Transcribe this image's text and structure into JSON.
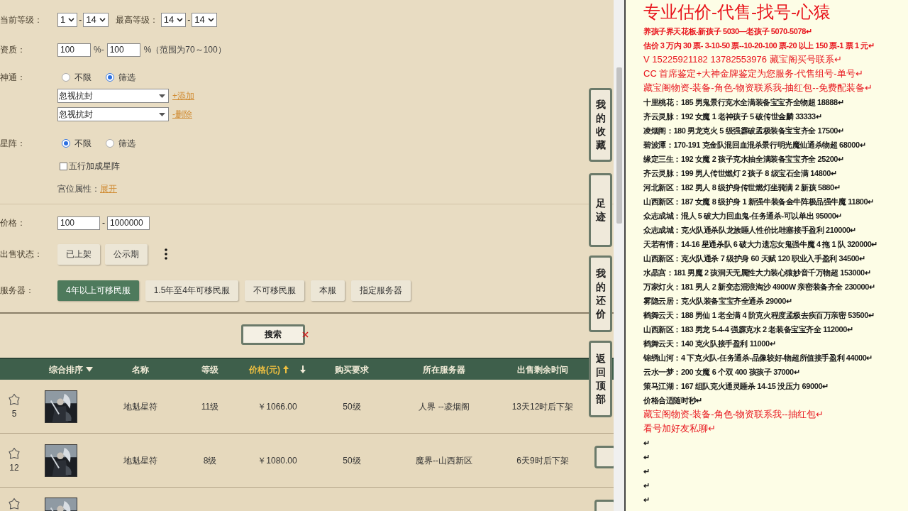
{
  "filters": {
    "level": {
      "label": "当前等级：",
      "from": "1",
      "dash": "-",
      "to": "14",
      "max_label": "最高等级：",
      "max_from": "14",
      "max_to": "14"
    },
    "aptitude": {
      "label": "资质：",
      "from": "100",
      "unit": "%",
      "dash": "-",
      "to": "100",
      "hint": "%（范围为70～100）"
    },
    "skills": {
      "label": "神通：",
      "options": [
        {
          "label": "不限",
          "selected": false
        },
        {
          "label": "筛选",
          "selected": true
        }
      ],
      "selects": [
        {
          "value": "忽视抗封",
          "link": "+添加"
        },
        {
          "value": "忽视抗封",
          "link": "-删除"
        }
      ]
    },
    "star_array": {
      "label": "星阵：",
      "options": [
        {
          "label": "不限",
          "selected": true
        },
        {
          "label": "筛选",
          "selected": false
        }
      ],
      "checkbox": {
        "label": "五行加成星阵",
        "checked": false
      },
      "palace_label": "宫位属性：",
      "palace_link": "展开"
    },
    "price": {
      "label": "价格：",
      "from": "100",
      "dash": "-",
      "to": "1000000"
    },
    "sale_status": {
      "label": "出售状态：",
      "options": [
        {
          "label": "已上架",
          "selected": false
        },
        {
          "label": "公示期",
          "selected": false
        }
      ]
    },
    "server": {
      "label": "服务器：",
      "options": [
        {
          "label": "4年以上可移民服",
          "selected": true
        },
        {
          "label": "1.5年至4年可移民服",
          "selected": false
        },
        {
          "label": "不可移民服",
          "selected": false
        },
        {
          "label": "本服",
          "selected": false
        },
        {
          "label": "指定服务器",
          "selected": false
        }
      ]
    }
  },
  "search_button": "搜索",
  "table": {
    "columns": [
      {
        "label": "综合排序",
        "selected": false
      },
      {
        "label": "名称",
        "selected": false
      },
      {
        "label": "等级",
        "selected": false
      },
      {
        "label": "价格(元)",
        "selected": true
      },
      {
        "label": "购买要求",
        "selected": false
      },
      {
        "label": "所在服务器",
        "selected": false
      },
      {
        "label": "出售剩余时间",
        "selected": false
      }
    ],
    "rows": [
      {
        "count": "5",
        "name": "地魁星符",
        "level": "11级",
        "price": "￥1066.00",
        "requirement": "50级",
        "server": "人界 --凌烟阁",
        "time": "13天12时后下架"
      },
      {
        "count": "12",
        "name": "地魁星符",
        "level": "8级",
        "price": "￥1080.00",
        "requirement": "50级",
        "server": "魔界--山西新区",
        "time": "6天9时后下架"
      }
    ]
  },
  "side_buttons": [
    "我的收藏",
    "足迹",
    "我的还价",
    "返回顶部"
  ],
  "document": {
    "lines": [
      {
        "kind": "title",
        "color": "#e8141c",
        "text": "专业估价-代售-找号-心猿"
      },
      {
        "kind": "normal",
        "color": "#e8141c",
        "text": "养孩子界天花板-新孩子 5030—老孩子 5070-5078↵"
      },
      {
        "kind": "normal",
        "color": "#e8141c",
        "text": "估价 3 万内 30 票- 3-10-50 票--10-20-100 票-20 以上 150 票-1 票 1 元↵"
      },
      {
        "kind": "large",
        "color": "#e8141c",
        "text": "V 15225921182     13782553976    藏宝阁买号联系↵"
      },
      {
        "kind": "large",
        "color": "#e8141c",
        "text": "CC 首席鉴定+大神金牌鉴定为您服务-代售组号-单号↵"
      },
      {
        "kind": "large",
        "color": "#e8141c",
        "text": "藏宝阁物资-装备-角色-物资联系我-抽红包--免费配装备↵"
      },
      {
        "kind": "normal",
        "color": "#1a1a1a",
        "text": "十里桃花：185 男鬼景行克水全满装备宝宝齐全物超 18888↵"
      },
      {
        "kind": "normal",
        "color": "#1a1a1a",
        "text": "齐云灵脉：192 女魔 1 老神孩子 5 破传世金麟 33333↵"
      },
      {
        "kind": "normal",
        "color": "#1a1a1a",
        "text": "凌烟阁：180 男龙克火 5 级强霹破孟极装备宝宝齐全 17500↵"
      },
      {
        "kind": "normal",
        "color": "#1a1a1a",
        "text": "碧波潭：170-191 克金队混回血混杀景行明光魔仙通杀物超 68000↵"
      },
      {
        "kind": "normal",
        "color": "#1a1a1a",
        "text": "缘定三生：192 女魔 2 孩子克水抽全满装备宝宝齐全 25200↵"
      },
      {
        "kind": "normal",
        "color": "#1a1a1a",
        "text": "齐云灵脉：199 男人传世燃灯 2 孩子 8 级宝石全满 14800↵"
      },
      {
        "kind": "normal",
        "color": "#1a1a1a",
        "text": "河北新区：182 男人 8 级护身传世燃灯坐骑满 2 新孩 5880↵"
      },
      {
        "kind": "normal",
        "color": "#1a1a1a",
        "text": "山西新区：187 女魔 8 级护身 1 新强牛装备金牛阵极品强牛魔 11800↵"
      },
      {
        "kind": "normal",
        "color": "#1a1a1a",
        "text": "众志成城：混人 5 破大力回血鬼-任务通杀-可以单出 95000↵"
      },
      {
        "kind": "normal",
        "color": "#1a1a1a",
        "text": "众志成城：克火队通杀队龙族睡人性价比哇塞接手盈利 210000↵"
      },
      {
        "kind": "normal",
        "color": "#1a1a1a",
        "text": "天若有情：14-16 星通杀队 6 破大力遗忘女鬼强牛魔 4 拖 1 队 320000↵"
      },
      {
        "kind": "normal",
        "color": "#1a1a1a",
        "text": "山西新区：克火队通杀 7 级护身 60 天赋 120 职业入手盈利 34500↵"
      },
      {
        "kind": "normal",
        "color": "#1a1a1a",
        "text": "水晶宫：181 男魔 2 孩洞天无属性大力装心猿妙音千万物超 153000↵"
      },
      {
        "kind": "normal",
        "color": "#1a1a1a",
        "text": "万家灯火：181 男人 2 新变态混浪淘沙 4900W 亲密装备齐全 230000↵"
      },
      {
        "kind": "normal",
        "color": "#1a1a1a",
        "text": "雾隐云居：克火队装备宝宝齐全通杀 29000↵"
      },
      {
        "kind": "normal",
        "color": "#1a1a1a",
        "text": "鹤舞云天：188 男仙 1 老全满 4 阶克火程度孟极去疾百万亲密 53500↵"
      },
      {
        "kind": "normal",
        "color": "#1a1a1a",
        "text": "山西新区：183 男龙 5-4-4 强霹克水 2 老装备宝宝齐全 112000↵"
      },
      {
        "kind": "normal",
        "color": "#1a1a1a",
        "text": "鹤舞云天：140 克火队接手盈利 11000↵"
      },
      {
        "kind": "normal",
        "color": "#1a1a1a",
        "text": "锦绣山河：4 下克火队-任务通杀-品像较好-物超所值接手盈利 44000↵"
      },
      {
        "kind": "normal",
        "color": "#1a1a1a",
        "text": "云水一梦：200 女魔 6 个双 400 孩孩子 37000↵"
      },
      {
        "kind": "normal",
        "color": "#1a1a1a",
        "text": "策马江湖：167 组队克火通灵睡杀 14-15 没压力 69000↵"
      },
      {
        "kind": "normal",
        "color": "#1a1a1a",
        "text": "价格合适随时秒↵"
      },
      {
        "kind": "large",
        "color": "#e8141c",
        "text": "藏宝阁物资-装备-角色-物资联系我--抽红包↵"
      },
      {
        "kind": "large",
        "color": "#e8141c",
        "text": "看号加好友私聊↵"
      },
      {
        "kind": "normal",
        "color": "#1a1a1a",
        "text": "↵"
      },
      {
        "kind": "normal",
        "color": "#1a1a1a",
        "text": "↵"
      },
      {
        "kind": "normal",
        "color": "#1a1a1a",
        "text": "↵"
      },
      {
        "kind": "normal",
        "color": "#1a1a1a",
        "text": "↵"
      },
      {
        "kind": "normal",
        "color": "#1a1a1a",
        "text": "↵"
      }
    ]
  }
}
